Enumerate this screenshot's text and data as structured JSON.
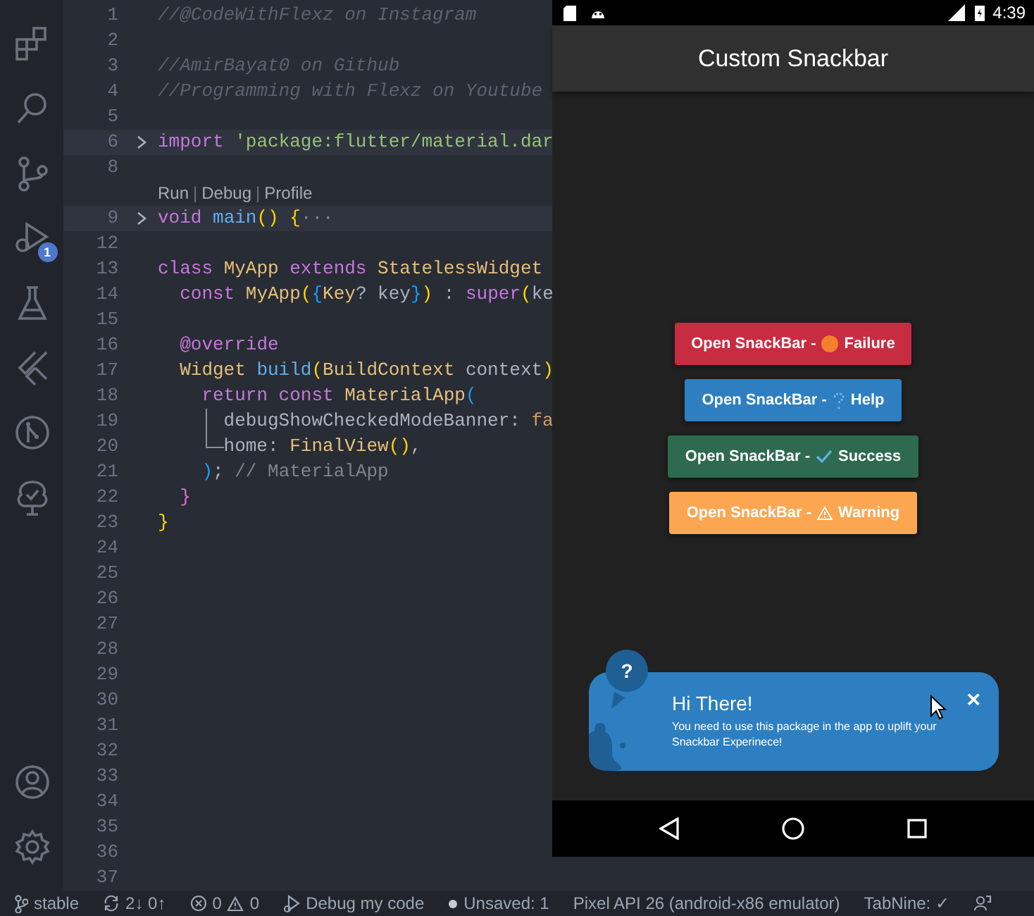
{
  "activity_bar": {
    "run_badge": "1"
  },
  "editor": {
    "lines": [
      {
        "number": "1",
        "tokens": [
          {
            "kind": "comment",
            "text": "//@CodeWithFlexz on Instagram"
          }
        ]
      },
      {
        "number": "2"
      },
      {
        "number": "3",
        "tokens": [
          {
            "kind": "comment",
            "text": "//AmirBayat0 on Github"
          }
        ]
      },
      {
        "number": "4",
        "tokens": [
          {
            "kind": "comment",
            "text": "//Programming with Flexz on Youtube"
          }
        ]
      },
      {
        "number": "5"
      },
      {
        "number": "6",
        "folded": true,
        "highlighted": true,
        "tokens": [
          {
            "kind": "keyword",
            "text": "import "
          },
          {
            "kind": "string",
            "text": "'package:flutter/material.dar"
          }
        ]
      },
      {
        "number": "8"
      },
      {
        "codelens": [
          {
            "kind": "link",
            "text": "Run"
          },
          {
            "kind": "sep",
            "text": "|"
          },
          {
            "kind": "link",
            "text": "Debug"
          },
          {
            "kind": "sep",
            "text": "|"
          },
          {
            "kind": "link",
            "text": "Profile"
          }
        ]
      },
      {
        "number": "9",
        "folded": true,
        "highlighted": true,
        "tokens": [
          {
            "kind": "keyword",
            "text": "void "
          },
          {
            "kind": "function",
            "text": "main"
          },
          {
            "kind": "bracket1",
            "text": "() {"
          },
          {
            "kind": "fold",
            "text": "···"
          }
        ]
      },
      {
        "number": "12"
      },
      {
        "number": "13",
        "tokens": [
          {
            "kind": "keyword",
            "text": "class "
          },
          {
            "kind": "type",
            "text": "MyApp "
          },
          {
            "kind": "keyword",
            "text": "extends "
          },
          {
            "kind": "type",
            "text": "StatelessWidget"
          }
        ],
        "children": [
          {
            "number": "14",
            "tokens": [
              {
                "kind": "keyword",
                "text": "const "
              },
              {
                "kind": "type",
                "text": "MyApp"
              },
              {
                "kind": "bracket1",
                "text": "("
              },
              {
                "kind": "bracket3",
                "text": "{"
              },
              {
                "kind": "type",
                "text": "Key"
              },
              {
                "kind": "plain",
                "text": "? key"
              },
              {
                "kind": "bracket3",
                "text": "}"
              },
              {
                "kind": "bracket1",
                "text": ")"
              },
              {
                "kind": "plain",
                "text": " : "
              },
              {
                "kind": "keyword",
                "text": "super"
              },
              {
                "kind": "bracket1",
                "text": "("
              },
              {
                "kind": "plain",
                "text": "ke"
              }
            ]
          },
          {
            "number": "15"
          },
          {
            "number": "16",
            "tokens": [
              {
                "kind": "keyword",
                "text": "@override"
              }
            ]
          },
          {
            "number": "17",
            "tokens": [
              {
                "kind": "type",
                "text": "Widget "
              },
              {
                "kind": "function",
                "text": "build"
              },
              {
                "kind": "bracket1",
                "text": "("
              },
              {
                "kind": "type",
                "text": "BuildContext "
              },
              {
                "kind": "plain",
                "text": "context"
              },
              {
                "kind": "bracket1",
                "text": ")"
              }
            ],
            "children": [
              {
                "number": "18",
                "tokens": [
                  {
                    "kind": "keyword",
                    "text": "return const "
                  },
                  {
                    "kind": "type",
                    "text": "MaterialApp"
                  },
                  {
                    "kind": "bracket3",
                    "text": "("
                  }
                ],
                "children": [
                  {
                    "number": "19",
                    "tokens": [
                      {
                        "kind": "guideline"
                      },
                      {
                        "kind": "plain",
                        "text": "debugShowCheckedModeBanner: "
                      },
                      {
                        "kind": "literal",
                        "text": "fa"
                      }
                    ]
                  },
                  {
                    "number": "20",
                    "tokens": [
                      {
                        "kind": "guidecorner"
                      },
                      {
                        "kind": "plain",
                        "text": "home: "
                      },
                      {
                        "kind": "type",
                        "text": "FinalView"
                      },
                      {
                        "kind": "bracket1",
                        "text": "()"
                      },
                      {
                        "kind": "plain",
                        "text": ","
                      }
                    ]
                  }
                ]
              },
              {
                "number": "21",
                "tokens": [
                  {
                    "kind": "bracket3",
                    "text": ")"
                  },
                  {
                    "kind": "plain",
                    "text": "; "
                  },
                  {
                    "kind": "label",
                    "text": "// MaterialApp"
                  }
                ]
              }
            ]
          },
          {
            "number": "22",
            "tokens": [
              {
                "kind": "bracket2",
                "text": "}"
              }
            ]
          }
        ]
      },
      {
        "number": "23",
        "tokens": [
          {
            "kind": "bracket1",
            "text": "}"
          }
        ]
      },
      {
        "number": "24"
      },
      {
        "number": "25"
      },
      {
        "number": "26"
      },
      {
        "number": "27"
      },
      {
        "number": "28"
      },
      {
        "number": "29"
      },
      {
        "number": "30"
      },
      {
        "number": "31"
      },
      {
        "number": "32"
      },
      {
        "number": "33"
      },
      {
        "number": "34"
      },
      {
        "number": "35"
      },
      {
        "number": "36"
      },
      {
        "number": "37"
      }
    ]
  },
  "phone": {
    "time": "4:39",
    "app_bar_title": "Custom Snackbar",
    "buttons": [
      {
        "kind": "failure",
        "prefix": "Open SnackBar -",
        "label": "Failure"
      },
      {
        "kind": "help",
        "prefix": "Open SnackBar -",
        "label": "Help"
      },
      {
        "kind": "success",
        "prefix": "Open SnackBar -",
        "label": "Success"
      },
      {
        "kind": "warning",
        "prefix": "Open SnackBar -",
        "label": "Warning"
      }
    ],
    "snackbar": {
      "kind": "help",
      "badge": "?",
      "title": "Hi There!",
      "message": "You need to use this package in the app to uplift your Snackbar Experinece!",
      "close": "×"
    }
  },
  "status_bar": {
    "items": [
      {
        "kind": "branch",
        "text": "stable"
      },
      {
        "kind": "sync",
        "text": "2↓ 0↑"
      },
      {
        "kind": "problems",
        "errors": "0",
        "warnings": "0"
      },
      {
        "kind": "debug",
        "text": "Debug my code"
      },
      {
        "kind": "unsaved",
        "text": "Unsaved: 1"
      },
      {
        "kind": "device",
        "text": "Pixel API 26 (android-x86 emulator)"
      },
      {
        "kind": "tabnine",
        "text": "TabNine: ✓"
      },
      {
        "kind": "feedback"
      }
    ]
  }
}
